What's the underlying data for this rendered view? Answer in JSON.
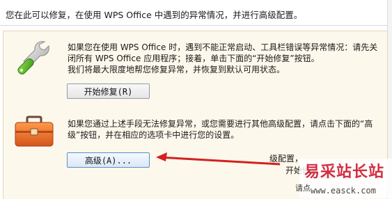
{
  "header": {
    "text": "您在此可以修复，在使用 WPS Office 中遇到的异常情况，并进行高级配置。"
  },
  "repair": {
    "description_lines": [
      "如果您在使用 WPS Office 时，遇到不能正常启动、工具栏错误等异常情况：请先关",
      "闭所有 WPS Office 应用程序；接着，单击下面的“开始修复”按钮。",
      "我们将最大限度地帮您修复异常，并恢复到默认可用状态。"
    ],
    "button_label": "开始修复(R)",
    "icon": "wrench-icon"
  },
  "advanced": {
    "description_lines": [
      "如果您通过上述手段无法修复异常，或您需要进行其他高级配置，请点击下面的“高",
      "级”按钮，并在相应的选项卡中进行您的设置。"
    ],
    "button_label": "高级(A)...",
    "icon": "toolbox-icon",
    "partial_text_1": "级配置，",
    "partial_text_2": "开始修复",
    "partial_text_3": "请点"
  },
  "annotation": {
    "arrow_color": "#d42020"
  },
  "watermark": {
    "logo": "易采站长站",
    "url": "www.easck.com",
    "color": "#d22d40"
  }
}
